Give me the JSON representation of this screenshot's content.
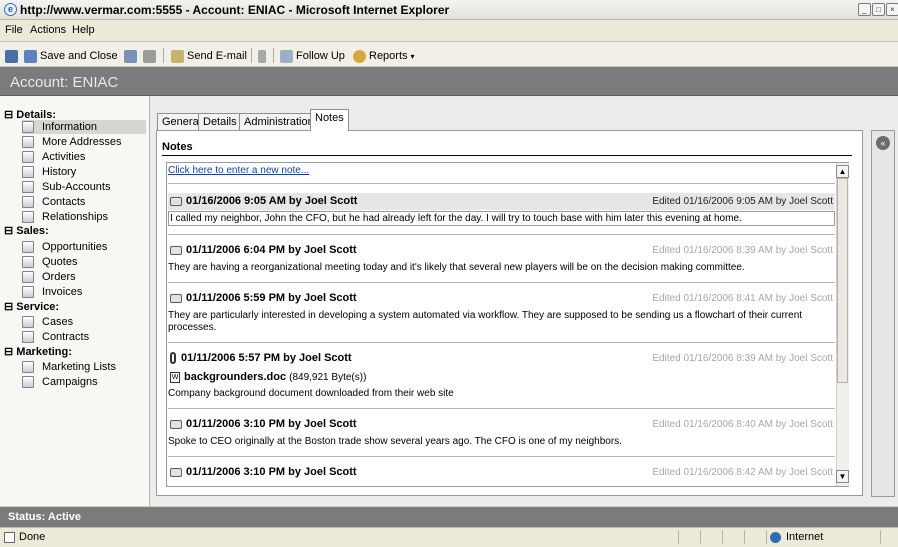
{
  "window": {
    "title": "http://www.vermar.com:5555 - Account: ENIAC - Microsoft Internet Explorer"
  },
  "menu": [
    "File",
    "Actions",
    "Help"
  ],
  "toolbar": {
    "save_close": "Save and Close",
    "send_email": "Send E-mail",
    "follow_up": "Follow Up",
    "reports": "Reports"
  },
  "account": {
    "title": "Account: ENIAC"
  },
  "nav": {
    "details_header": "Details:",
    "details": [
      "Information",
      "More Addresses",
      "Activities",
      "History",
      "Sub-Accounts",
      "Contacts",
      "Relationships"
    ],
    "sales_header": "Sales:",
    "sales": [
      "Opportunities",
      "Quotes",
      "Orders",
      "Invoices"
    ],
    "service_header": "Service:",
    "service": [
      "Cases",
      "Contracts"
    ],
    "marketing_header": "Marketing:",
    "marketing": [
      "Marketing Lists",
      "Campaigns"
    ]
  },
  "tabs": [
    "General",
    "Details",
    "Administration",
    "Notes"
  ],
  "notes_panel": {
    "title": "Notes",
    "new_note_link": "Click here to enter a new note...",
    "notes": [
      {
        "title": "01/16/2006 9:05 AM by Joel Scott",
        "edited": "Edited 01/16/2006 9:05 AM by Joel Scott",
        "body": "I called my neighbor, John the CFO, but he had already left for the day. I will try to touch base with him later this evening at home."
      },
      {
        "title": "01/11/2006 6:04 PM by Joel Scott",
        "edited": "Edited 01/16/2006 8:39 AM by Joel Scott",
        "body": "They are having a reorganizational meeting today and it's likely that several new players will be on the decision making committee."
      },
      {
        "title": "01/11/2006 5:59 PM by Joel Scott",
        "edited": "Edited 01/16/2006 8:41 AM by Joel Scott",
        "body": "They are particularly interested in developing a system automated via workflow. They are supposed to be sending us a flowchart of their current processes."
      },
      {
        "title": "01/11/2006 5:57 PM by Joel Scott",
        "edited": "Edited 01/16/2006 8:39 AM by Joel Scott",
        "attachment": "backgrounders.doc",
        "attachment_size": "(849,921 Byte(s))",
        "body": "Company background document downloaded from their web site"
      },
      {
        "title": "01/11/2006 3:10 PM by Joel Scott",
        "edited": "Edited 01/16/2006 8:40 AM by Joel Scott",
        "body": "Spoke to CEO originally at the Boston trade show several years ago. The CFO is one of my neighbors."
      },
      {
        "title": "01/11/2006 3:10 PM by Joel Scott",
        "edited": "Edited 01/16/2006 8:42 AM by Joel Scott",
        "body": ""
      }
    ]
  },
  "status": {
    "label": "Status: Active"
  },
  "ie_status": {
    "left": "Done",
    "zone": "Internet"
  }
}
